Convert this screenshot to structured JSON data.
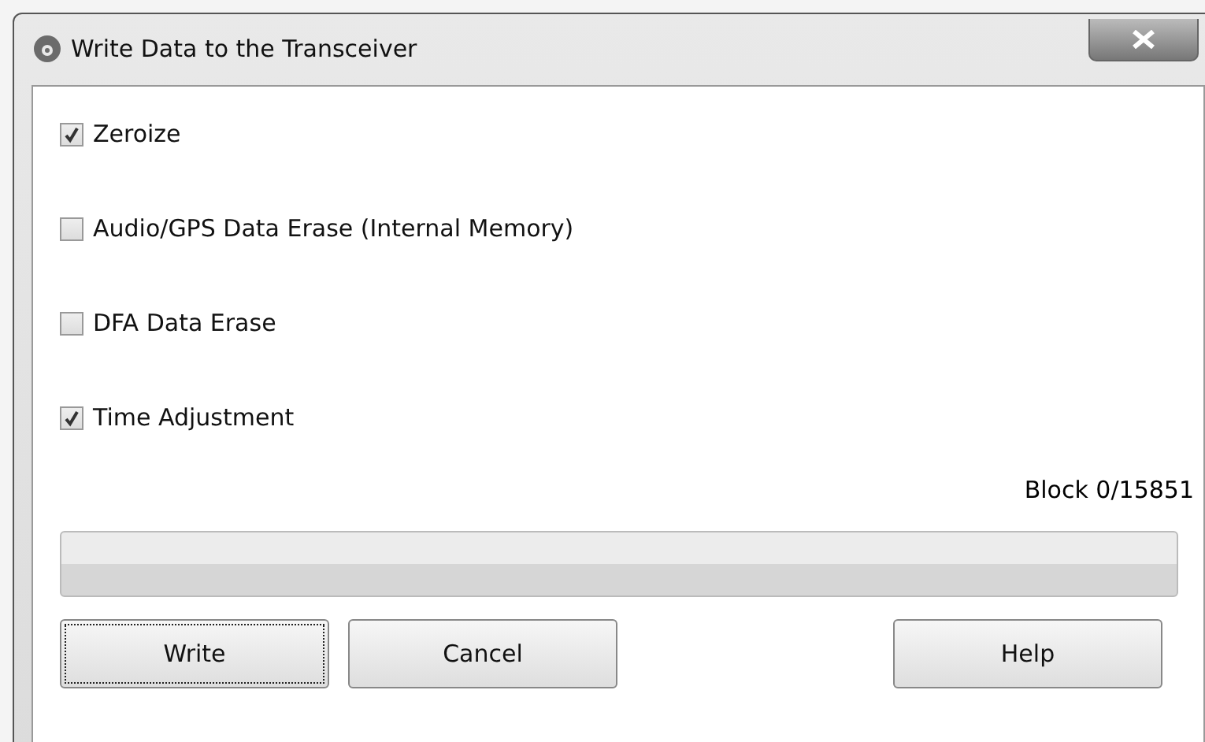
{
  "window": {
    "title": "Write Data to the Transceiver"
  },
  "options": [
    {
      "label": "Zeroize",
      "checked": true
    },
    {
      "label": "Audio/GPS Data Erase (Internal Memory)",
      "checked": false
    },
    {
      "label": "DFA Data Erase",
      "checked": false
    },
    {
      "label": "Time Adjustment",
      "checked": true
    }
  ],
  "block_status": "Block 0/15851",
  "progress": {
    "level": 0
  },
  "buttons": [
    {
      "label": "Write",
      "focused": true
    },
    {
      "label": "Cancel",
      "focused": false
    },
    {
      "label": "Help",
      "focused": false
    }
  ]
}
